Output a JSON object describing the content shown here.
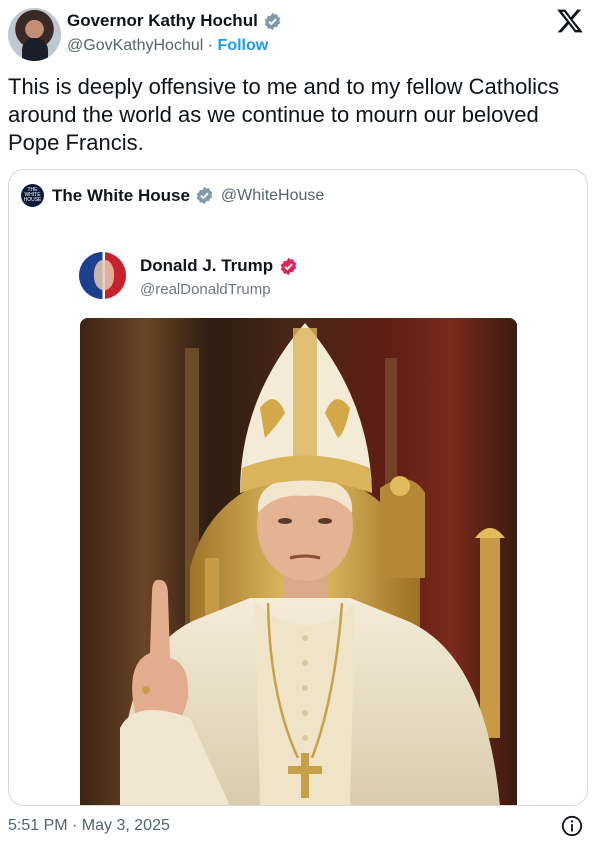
{
  "author": {
    "name": "Governor Kathy Hochul",
    "handle": "@GovKathyHochul",
    "separator": "·",
    "follow_label": "Follow",
    "verified_color": "#829aab"
  },
  "tweet": {
    "text": "This is deeply offensive to me and to my fellow Catholics around the world as we continue to mourn our beloved Pope Francis."
  },
  "quoted": {
    "name": "The White House",
    "handle": "@WhiteHouse",
    "avatar_text": "THE WHITE HOUSE",
    "verified_color": "#829aab",
    "media": {
      "name": "Donald J. Trump",
      "handle": "@realDonaldTrump",
      "verified_color": "#e0245e",
      "image": "Trump dressed as the pope in white and gold vestments, seated on a gilded throne, raising one finger"
    }
  },
  "footer": {
    "timestamp": "5:51 PM · May 3, 2025"
  },
  "icons": {
    "brand": "x-logo-icon",
    "info": "info-icon"
  }
}
